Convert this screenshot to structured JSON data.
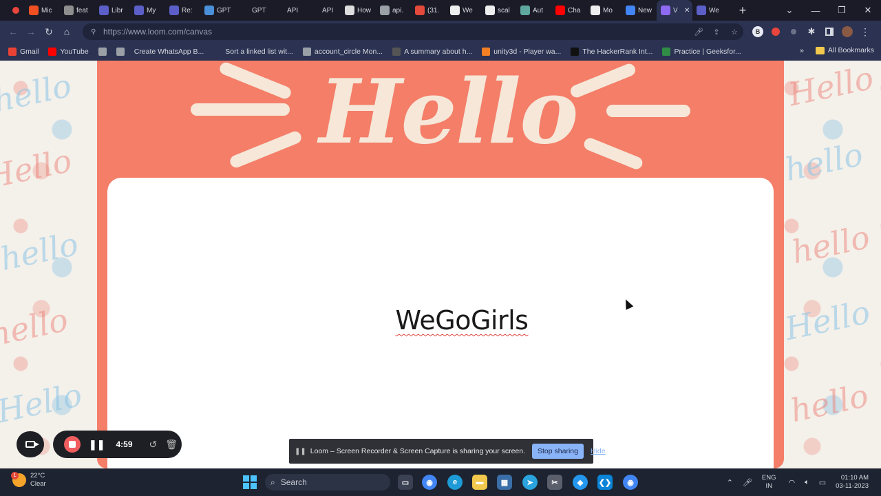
{
  "browser": {
    "tabs": [
      {
        "label": "Mic",
        "icon": "microsoft-icon",
        "color": "#f25022"
      },
      {
        "label": "feat",
        "icon": "loading-icon",
        "color": "#8e8e8e"
      },
      {
        "label": "Libr",
        "icon": "gear-icon",
        "color": "#5b5fc7"
      },
      {
        "label": "My",
        "icon": "gear-icon",
        "color": "#5b5fc7"
      },
      {
        "label": "Re:",
        "icon": "gear-icon",
        "color": "#5b5fc7"
      },
      {
        "label": "GPT",
        "icon": "openai-icon",
        "color": "#4a90d9"
      },
      {
        "label": "GPT",
        "icon": "openai-icon",
        "color": "#1a1b26"
      },
      {
        "label": "API",
        "icon": "openai-icon",
        "color": "#1a1b26"
      },
      {
        "label": "API",
        "icon": "openai-icon",
        "color": "#1a1b26"
      },
      {
        "label": "How",
        "icon": "doc-icon",
        "color": "#dddddd"
      },
      {
        "label": "api.",
        "icon": "globe-icon",
        "color": "#9aa0a6"
      },
      {
        "label": "(31.",
        "icon": "save-icon",
        "color": "#e34a3b"
      },
      {
        "label": "We",
        "icon": "github-icon",
        "color": "#eeeeee"
      },
      {
        "label": "scal",
        "icon": "github-icon",
        "color": "#eeeeee"
      },
      {
        "label": "Aut",
        "icon": "app-icon",
        "color": "#5fa8a0"
      },
      {
        "label": "Cha",
        "icon": "youtube-icon",
        "color": "#ff0000"
      },
      {
        "label": "Mo",
        "icon": "github-icon",
        "color": "#eeeeee"
      },
      {
        "label": "New",
        "icon": "chrome-icon",
        "color": "#4285f4"
      },
      {
        "label": "V",
        "icon": "audio-icon",
        "color": "#8f6af2",
        "active": true
      },
      {
        "label": "We",
        "icon": "gear-icon",
        "color": "#5b5fc7"
      }
    ],
    "url": "https://www.loom.com/canvas",
    "profile_initial": "B",
    "bookmarks": [
      {
        "label": "Gmail",
        "icon": "gmail-icon",
        "color": "#ea4335"
      },
      {
        "label": "YouTube",
        "icon": "youtube-icon",
        "color": "#ff0000"
      },
      {
        "label": "",
        "icon": "globe-icon",
        "color": "#9aa0a6"
      },
      {
        "label": "",
        "icon": "globe-icon",
        "color": "#9aa0a6"
      },
      {
        "label": "Create WhatsApp B...",
        "icon": "",
        "color": "#2b3252"
      },
      {
        "label": "Sort a linked list wit...",
        "icon": "tc-icon",
        "color": "#2b3252"
      },
      {
        "label": "account_circle Mon...",
        "icon": "globe-icon",
        "color": "#9aa0a6"
      },
      {
        "label": "A summary about h...",
        "icon": "hf-icon",
        "color": "#555555"
      },
      {
        "label": "unity3d - Player wa...",
        "icon": "so-icon",
        "color": "#f48024"
      },
      {
        "label": "The HackerRank Int...",
        "icon": "hackerrank-icon",
        "color": "#111111"
      },
      {
        "label": "Practice | Geeksfor...",
        "icon": "gfg-icon",
        "color": "#2f8d46"
      }
    ],
    "all_bookmarks": "All Bookmarks"
  },
  "canvas": {
    "header_word": "Hello",
    "name": "WeGoGirls",
    "background_word_a": "Hello",
    "background_word_b": "hello",
    "accent_color": "#f47e68"
  },
  "loom_controls": {
    "timer": "4:59"
  },
  "share_notice": {
    "text": "Loom – Screen Recorder & Screen Capture is sharing your screen.",
    "stop_button": "Stop sharing",
    "hide_link": "Hide"
  },
  "taskbar": {
    "weather_temp": "22°C",
    "weather_desc": "Clear",
    "weather_badge": "1",
    "search_label": "Search",
    "lang_line1": "ENG",
    "lang_line2": "IN",
    "time": "01:10 AM",
    "date": "03-11-2023"
  }
}
